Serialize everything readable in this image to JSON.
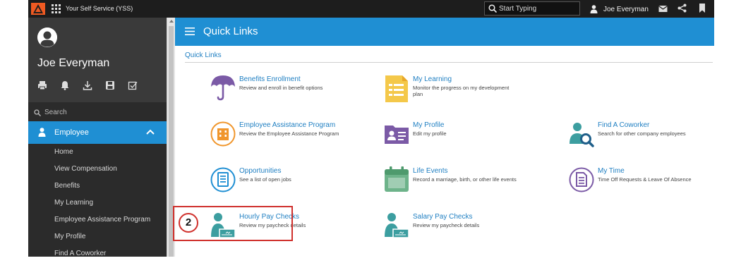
{
  "topbar": {
    "app_title": "Your Self Service (YSS)",
    "search_placeholder": "Start Typing",
    "user_name": "Joe Everyman",
    "icons": [
      "logo-icon",
      "apps-grid-icon",
      "search-icon",
      "user-icon",
      "mail-icon",
      "share-icon",
      "bookmark-icon"
    ]
  },
  "sidebar": {
    "user_name": "Joe Everyman",
    "tool_icons": [
      "print-icon",
      "bell-icon",
      "download-icon",
      "save-icon",
      "checklist-icon"
    ],
    "search_label": "Search",
    "active_section": "Employee",
    "items": [
      {
        "label": "Home"
      },
      {
        "label": "View Compensation"
      },
      {
        "label": "Benefits"
      },
      {
        "label": "My Learning"
      },
      {
        "label": "Employee Assistance Program"
      },
      {
        "label": "My Profile"
      },
      {
        "label": "Find A Coworker"
      }
    ]
  },
  "main": {
    "header_title": "Quick Links",
    "section_label": "Quick Links",
    "tiles": [
      {
        "title": "Benefits Enrollment",
        "desc": "Review and enroll in benefit options",
        "icon": "umbrella-icon"
      },
      {
        "title": "My Learning",
        "desc": "Monitor the progress on my development plan",
        "icon": "notepad-icon"
      },
      {
        "title": "Employee Assistance Program",
        "desc": "Review the Employee Assistance Program",
        "icon": "building-icon"
      },
      {
        "title": "My Profile",
        "desc": "Edit my profile",
        "icon": "profile-folder-icon"
      },
      {
        "title": "Find A Coworker",
        "desc": "Search for other company employees",
        "icon": "find-person-icon"
      },
      {
        "title": "Opportunities",
        "desc": "See a list of open jobs",
        "icon": "document-list-icon"
      },
      {
        "title": "Life Events",
        "desc": "Record a marriage, birth, or other life events",
        "icon": "calendar-icon"
      },
      {
        "title": "My Time",
        "desc": "Time Off Requests & Leave Of Absence",
        "icon": "time-document-icon"
      },
      {
        "title": "Hourly Pay Checks",
        "desc": "Review my paycheck details",
        "icon": "paycheck-icon"
      },
      {
        "title": "Salary Pay Checks",
        "desc": "Review my paycheck details",
        "icon": "paycheck-icon"
      }
    ],
    "callout_number": "2"
  },
  "colors": {
    "accent": "#1f8fd3",
    "topbar": "#1d1d1d",
    "sidebar": "#2b2b2b",
    "highlight": "#d0312d",
    "teal": "#3c9ea0"
  }
}
